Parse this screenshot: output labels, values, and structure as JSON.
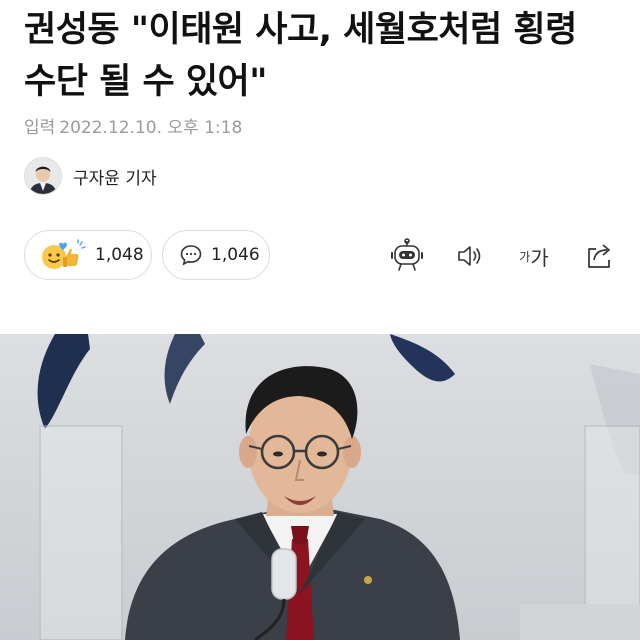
{
  "article": {
    "headline": "권성동 \"이태원 사고, 세월호처럼 횡령 수단 될 수 있어\"",
    "date_label": "입력",
    "date_value": "2022.12.10. 오후 1:18",
    "reporter": "구자윤 기자"
  },
  "reactions": {
    "like_count": "1,048",
    "comment_count": "1,046"
  },
  "toolbar": {
    "font_small": "가",
    "font_large": "가",
    "icons": [
      "robot-icon",
      "speaker-icon",
      "font-size-icon",
      "share-icon"
    ]
  },
  "colors": {
    "meta_text": "#9a9a9a",
    "pill_border": "#dcdcdc",
    "tie": "#8b1420"
  }
}
